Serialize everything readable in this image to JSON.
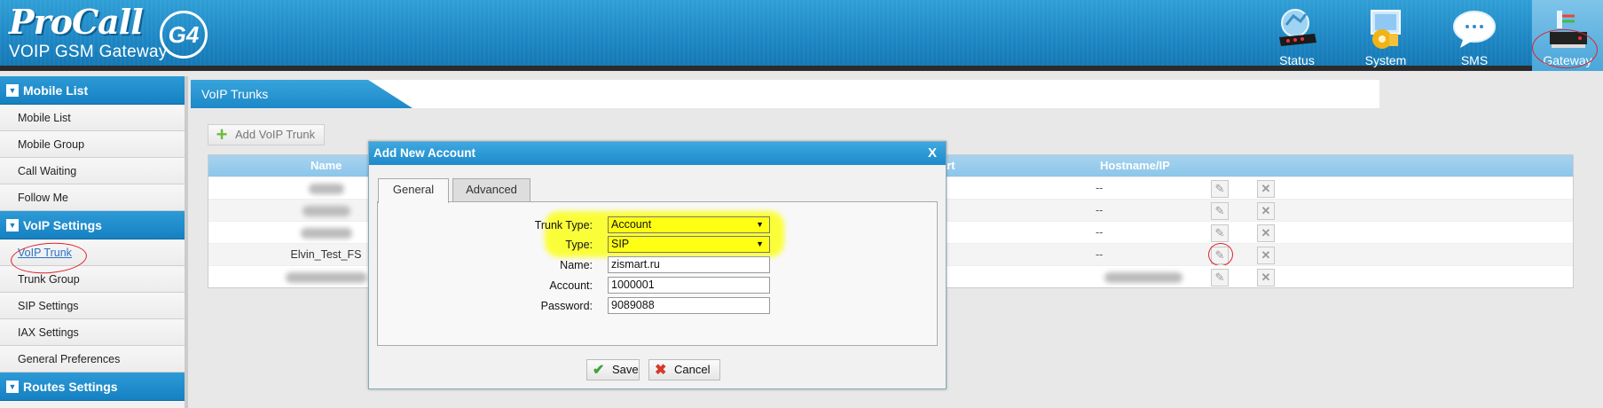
{
  "brand": {
    "name": "ProCall",
    "subtitle": "VOIP GSM Gateway",
    "badge": "G4"
  },
  "nav": [
    {
      "label": "Status",
      "icon": "router-status-icon"
    },
    {
      "label": "System",
      "icon": "system-gear-icon"
    },
    {
      "label": "SMS",
      "icon": "sms-bubble-icon"
    },
    {
      "label": "Gateway",
      "icon": "gateway-device-icon",
      "active": true
    }
  ],
  "sidebar": {
    "groups": [
      {
        "label": "Mobile List",
        "items": [
          "Mobile List",
          "Mobile Group",
          "Call Waiting",
          "Follow Me"
        ]
      },
      {
        "label": "VoIP Settings",
        "items": [
          "VoIP Trunk",
          "Trunk Group",
          "SIP Settings",
          "IAX Settings",
          "General Preferences"
        ]
      },
      {
        "label": "Routes Settings",
        "items": []
      }
    ],
    "active_item": "VoIP Trunk"
  },
  "main": {
    "tab_title": "VoIP Trunks",
    "add_button": "Add VoIP Trunk",
    "columns": {
      "name": "Name",
      "hidden": "art",
      "host": "Hostname/IP"
    },
    "rows": [
      {
        "name": "",
        "host": "--"
      },
      {
        "name": "",
        "host": "--"
      },
      {
        "name": "",
        "host": "--"
      },
      {
        "name": "Elvin_Test_FS",
        "host": "--"
      },
      {
        "name": "",
        "host": ""
      }
    ]
  },
  "dialog": {
    "title": "Add New Account",
    "close": "X",
    "tabs": [
      "General",
      "Advanced"
    ],
    "active_tab": "General",
    "fields": {
      "trunk_type": {
        "label": "Trunk Type:",
        "value": "Account"
      },
      "type": {
        "label": "Type:",
        "value": "SIP"
      },
      "name": {
        "label": "Name:",
        "value": "zismart.ru"
      },
      "account": {
        "label": "Account:",
        "value": "1000001"
      },
      "password": {
        "label": "Password:",
        "value": "9089088"
      }
    },
    "save": "Save",
    "cancel": "Cancel"
  },
  "colors": {
    "header": "#1d86c4",
    "highlight": "#ffff14",
    "annotation": "#e0222a"
  }
}
